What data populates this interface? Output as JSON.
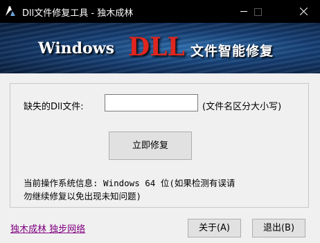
{
  "window": {
    "title": "Dll文件修复工具 - 独木成林",
    "icon": "app-icon"
  },
  "banner": {
    "word_windows": "Windows",
    "word_dll": "DLL",
    "word_sub": "文件智能修复",
    "colors": {
      "dll": "#e0261f",
      "background": "#163f74"
    }
  },
  "form": {
    "dll_label": "缺失的Dll文件:",
    "dll_value": "",
    "case_hint": "(文件名区分大小写)",
    "fix_button": "立即修复",
    "info_line1": "当前操作系统信息: Windows        64 位(如果检测有误请",
    "info_line2": "勿继续修复以免出现未知问题)"
  },
  "footer": {
    "link_text": "独木成林 独步网络",
    "about_button": "关于(A)",
    "exit_button": "退出(B)"
  }
}
